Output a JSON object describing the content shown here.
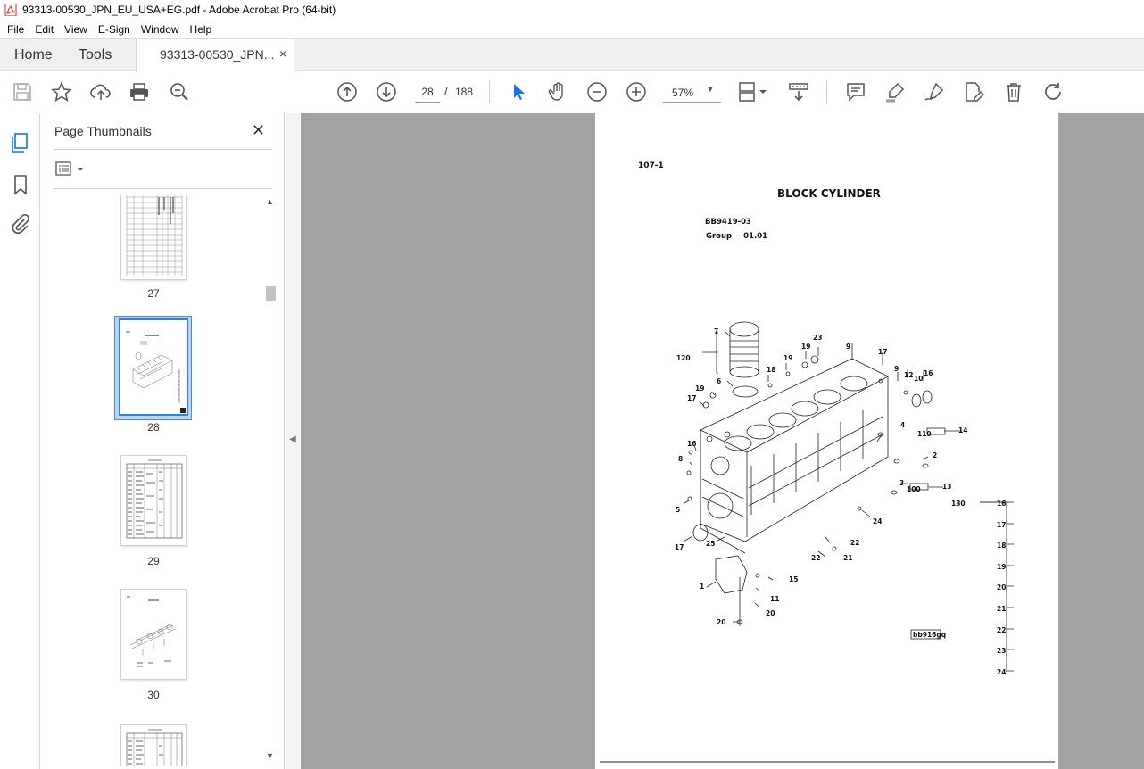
{
  "window": {
    "title": "93313-00530_JPN_EU_USA+EG.pdf - Adobe Acrobat Pro (64-bit)"
  },
  "menu": [
    "File",
    "Edit",
    "View",
    "E-Sign",
    "Window",
    "Help"
  ],
  "tabs": {
    "home": "Home",
    "tools": "Tools",
    "document": "93313-00530_JPN...",
    "close_symbol": "×"
  },
  "toolbar": {
    "current_page": "28",
    "page_separator": "/",
    "total_pages": "188",
    "zoom": "57%",
    "icons": [
      "save-icon",
      "star-icon",
      "upload-icon",
      "print-icon",
      "zoom-search-icon",
      "page-up-icon",
      "page-down-icon",
      "select-arrow-icon",
      "hand-icon",
      "zoom-out-icon",
      "zoom-in-icon",
      "page-layout-icon",
      "scroll-mode-icon",
      "comment-icon",
      "highlight-pen-icon",
      "sign-icon",
      "edit-pdf-icon",
      "delete-icon",
      "rotate-icon"
    ]
  },
  "sidebar": {
    "title": "Page Thumbnails",
    "close_symbol": "✕",
    "thumbnails": [
      {
        "page": "27",
        "selected": false
      },
      {
        "page": "28",
        "selected": true
      },
      {
        "page": "29",
        "selected": false
      },
      {
        "page": "30",
        "selected": false
      }
    ]
  },
  "document": {
    "page_ref": "107-1",
    "heading": "BLOCK CYLINDER",
    "part_code": "BB9419-03",
    "group": "Group − 01.01",
    "figure_code": "bb916gq",
    "callouts": [
      "7",
      "120",
      "6",
      "19",
      "17",
      "18",
      "19",
      "19",
      "23",
      "9",
      "17",
      "9",
      "12",
      "10",
      "16",
      "16",
      "8",
      "5",
      "4",
      "110",
      "14",
      "2",
      "3",
      "100",
      "13",
      "24",
      "17",
      "25",
      "22",
      "22",
      "21",
      "1",
      "15",
      "11",
      "20"
    ],
    "legend": {
      "group": "130",
      "items": [
        "16",
        "17",
        "18",
        "19",
        "20",
        "21",
        "22",
        "23",
        "24"
      ]
    }
  },
  "colors": {
    "accent": "#1473e6",
    "selection": "#3c80d0",
    "doc_background": "#a3a3a3"
  }
}
